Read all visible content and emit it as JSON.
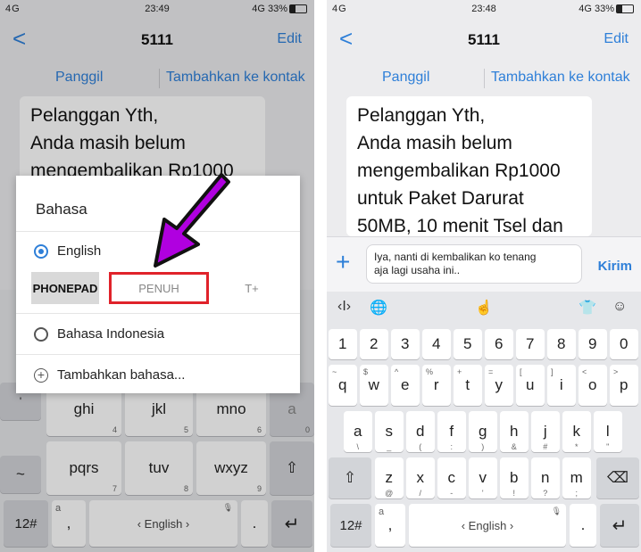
{
  "screen1": {
    "status": {
      "left": "4G",
      "time": "23:49",
      "right": "4G 33%"
    },
    "nav": {
      "back": "<",
      "title": "5111",
      "edit": "Edit"
    },
    "actions": {
      "call": "Panggil",
      "add": "Tambahkan ke kontak"
    },
    "message_lines": [
      "Pelanggan Yth,",
      "Anda masih belum",
      "mengembalikan Rp1000"
    ],
    "dialog": {
      "title": "Bahasa",
      "option1": "English",
      "tabs": [
        "PHONEPAD",
        "PENUH",
        "T+"
      ],
      "option2": "Bahasa Indonesia",
      "add": "Tambahkan bahasa..."
    },
    "keys": {
      "r1": [
        {
          "m": "ghi",
          "n": "4"
        },
        {
          "m": "jkl",
          "n": "5"
        },
        {
          "m": "mno",
          "n": "6"
        },
        {
          "m": "a",
          "n": "0"
        }
      ],
      "r2": [
        {
          "m": "pqrs",
          "n": "7"
        },
        {
          "m": "tuv",
          "n": "8"
        },
        {
          "m": "wxyz",
          "n": "9"
        }
      ],
      "num": "12#",
      "comma_top": "a",
      "comma": ",",
      "space": "‹ English ›",
      "dot": ".",
      "enter": "↵",
      "shift": "⇧",
      "tilde": "~"
    }
  },
  "screen2": {
    "status": {
      "left": "4G",
      "time": "23:48",
      "right": "4G 33%"
    },
    "nav": {
      "back": "<",
      "title": "5111",
      "edit": "Edit"
    },
    "actions": {
      "call": "Panggil",
      "add": "Tambahkan ke kontak"
    },
    "message_lines": [
      "Pelanggan Yth,",
      "Anda masih belum",
      "mengembalikan Rp1000",
      "untuk Paket Darurat",
      "50MB, 10 menit Tsel dan"
    ],
    "composer": {
      "line1": "Iya, nanti di kembalikan ko tenang",
      "line2": "aja lagi usaha ini..",
      "send": "Kirim"
    },
    "numbers": [
      "1",
      "2",
      "3",
      "4",
      "5",
      "6",
      "7",
      "8",
      "9",
      "0"
    ],
    "row1": [
      {
        "m": "q",
        "s": "~"
      },
      {
        "m": "w",
        "s": "$"
      },
      {
        "m": "e",
        "s": "^"
      },
      {
        "m": "r",
        "s": "%"
      },
      {
        "m": "t",
        "s": "+"
      },
      {
        "m": "y",
        "s": "="
      },
      {
        "m": "u",
        "s": "["
      },
      {
        "m": "i",
        "s": "]"
      },
      {
        "m": "o",
        "s": "<"
      },
      {
        "m": "p",
        "s": ">"
      }
    ],
    "row2": [
      {
        "m": "a",
        "s": "\\"
      },
      {
        "m": "s",
        "s": "_"
      },
      {
        "m": "d",
        "s": "("
      },
      {
        "m": "f",
        "s": ":"
      },
      {
        "m": "g",
        "s": ")"
      },
      {
        "m": "h",
        "s": "&"
      },
      {
        "m": "j",
        "s": "#"
      },
      {
        "m": "k",
        "s": "*"
      },
      {
        "m": "l",
        "s": "\""
      }
    ],
    "row3": [
      {
        "m": "z",
        "s": "@"
      },
      {
        "m": "x",
        "s": "/"
      },
      {
        "m": "c",
        "s": "-"
      },
      {
        "m": "v",
        "s": "'"
      },
      {
        "m": "b",
        "s": "!"
      },
      {
        "m": "n",
        "s": "?"
      },
      {
        "m": "m",
        "s": ";"
      }
    ],
    "num": "12#",
    "comma_top": "a",
    "comma": ",",
    "space": "‹ English ›",
    "dot": ".",
    "enter": "↵",
    "shift": "⇧",
    "backspace": "⌫"
  },
  "colors": {
    "accent": "#2e7fd8",
    "highlight": "#e0222a",
    "arrow": "#b000e0"
  }
}
